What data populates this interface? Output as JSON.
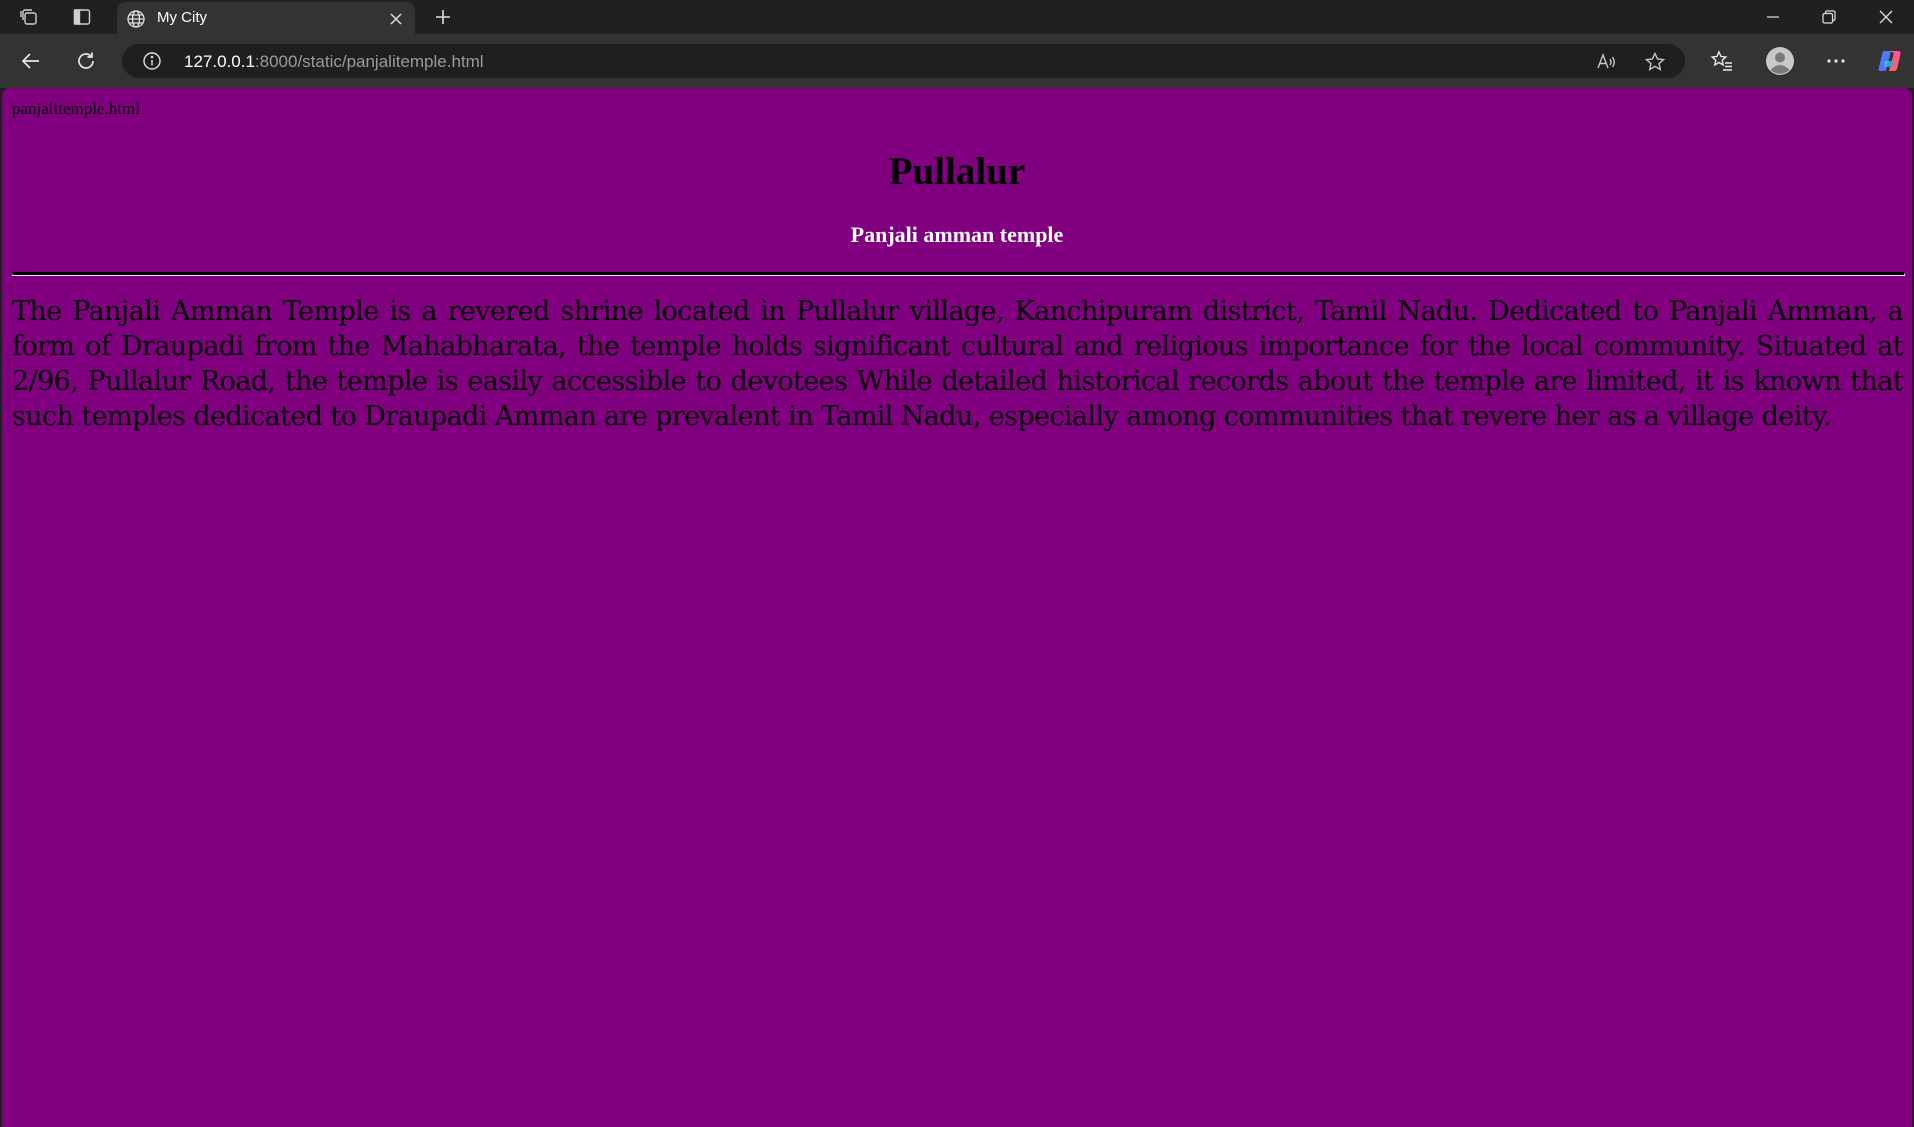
{
  "browser": {
    "tab": {
      "title": "My City",
      "favicon": "globe-icon"
    },
    "address_bar": {
      "url_host": "127.0.0.1",
      "url_rest": ":8000/static/panjalitemple.html"
    },
    "icons": {
      "workspaces": "workspaces-icon",
      "tab_actions": "tab-actions-icon",
      "close_tab": "close-icon",
      "new_tab": "plus-icon",
      "minimize": "minimize-icon",
      "restore": "restore-icon",
      "close_window": "close-icon",
      "back": "back-arrow-icon",
      "refresh": "refresh-icon",
      "site_info": "info-icon",
      "read_aloud": "read-aloud-icon",
      "favorite": "star-icon",
      "favorites": "favorites-icon",
      "profile": "profile-icon",
      "more": "more-icon",
      "copilot": "copilot-icon"
    },
    "colors": {
      "frame": "#202020",
      "toolbar": "#333333",
      "address_bg": "#1f1f1f"
    }
  },
  "page": {
    "filename": "panjalitemple.html",
    "title": "Pullalur",
    "subtitle": "Panjali amman temple",
    "body": "The Panjali Amman Temple is a revered shrine located in Pullalur village, Kanchipuram district, Tamil Nadu. Dedicated to Panjali Amman, a form of Draupadi from the Mahabharata, the temple holds significant cultural and religious importance for the local community. Situated at 2/96, Pullalur Road, the temple is easily accessible to devotees While detailed historical records about the temple are limited, it is known that such temples dedicated to Draupadi Amman are prevalent in Tamil Nadu, especially among communities that revere her as a village deity.",
    "colors": {
      "background": "#800080",
      "title": "#000000",
      "subtitle": "#ffffff",
      "text": "#000000"
    }
  }
}
